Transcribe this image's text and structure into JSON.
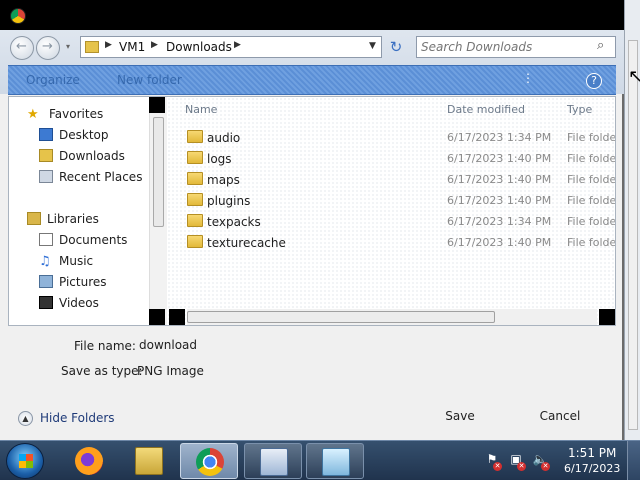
{
  "address": {
    "crumbs": [
      "VM1",
      "Downloads"
    ]
  },
  "search": {
    "placeholder": "Search Downloads"
  },
  "toolbar": {
    "organize_label": "Organize",
    "new_folder_label": "New folder"
  },
  "nav": {
    "favorites": {
      "header": "Favorites",
      "items": [
        "Desktop",
        "Downloads",
        "Recent Places"
      ]
    },
    "libraries": {
      "header": "Libraries",
      "items": [
        "Documents",
        "Music",
        "Pictures",
        "Videos"
      ]
    }
  },
  "list": {
    "columns": [
      "Name",
      "Date modified",
      "Type"
    ],
    "rows": [
      {
        "name": "audio",
        "date": "6/17/2023 1:34 PM",
        "type": "File folder"
      },
      {
        "name": "logs",
        "date": "6/17/2023 1:40 PM",
        "type": "File folder"
      },
      {
        "name": "maps",
        "date": "6/17/2023 1:40 PM",
        "type": "File folder"
      },
      {
        "name": "plugins",
        "date": "6/17/2023 1:40 PM",
        "type": "File folder"
      },
      {
        "name": "texpacks",
        "date": "6/17/2023 1:34 PM",
        "type": "File folder"
      },
      {
        "name": "texturecache",
        "date": "6/17/2023 1:40 PM",
        "type": "File folder"
      }
    ]
  },
  "form": {
    "file_name_label": "File name:",
    "file_name_value": "download",
    "save_as_type_label": "Save as type:",
    "save_as_type_value": "PNG Image"
  },
  "footer": {
    "hide_folders_label": "Hide Folders",
    "save_label": "Save",
    "cancel_label": "Cancel"
  },
  "taskbar": {
    "apps": [
      "firefox-icon",
      "explorer-icon",
      "chrome-icon",
      "settings-icon",
      "notepad-icon"
    ],
    "active_app": "chrome-icon",
    "clock_time": "1:51 PM",
    "clock_date": "6/17/2023"
  },
  "colors": {
    "toolbar_blue": "#5b8fd6",
    "folder_yellow": "#e2b93a",
    "taskbar": "#2a4160"
  }
}
